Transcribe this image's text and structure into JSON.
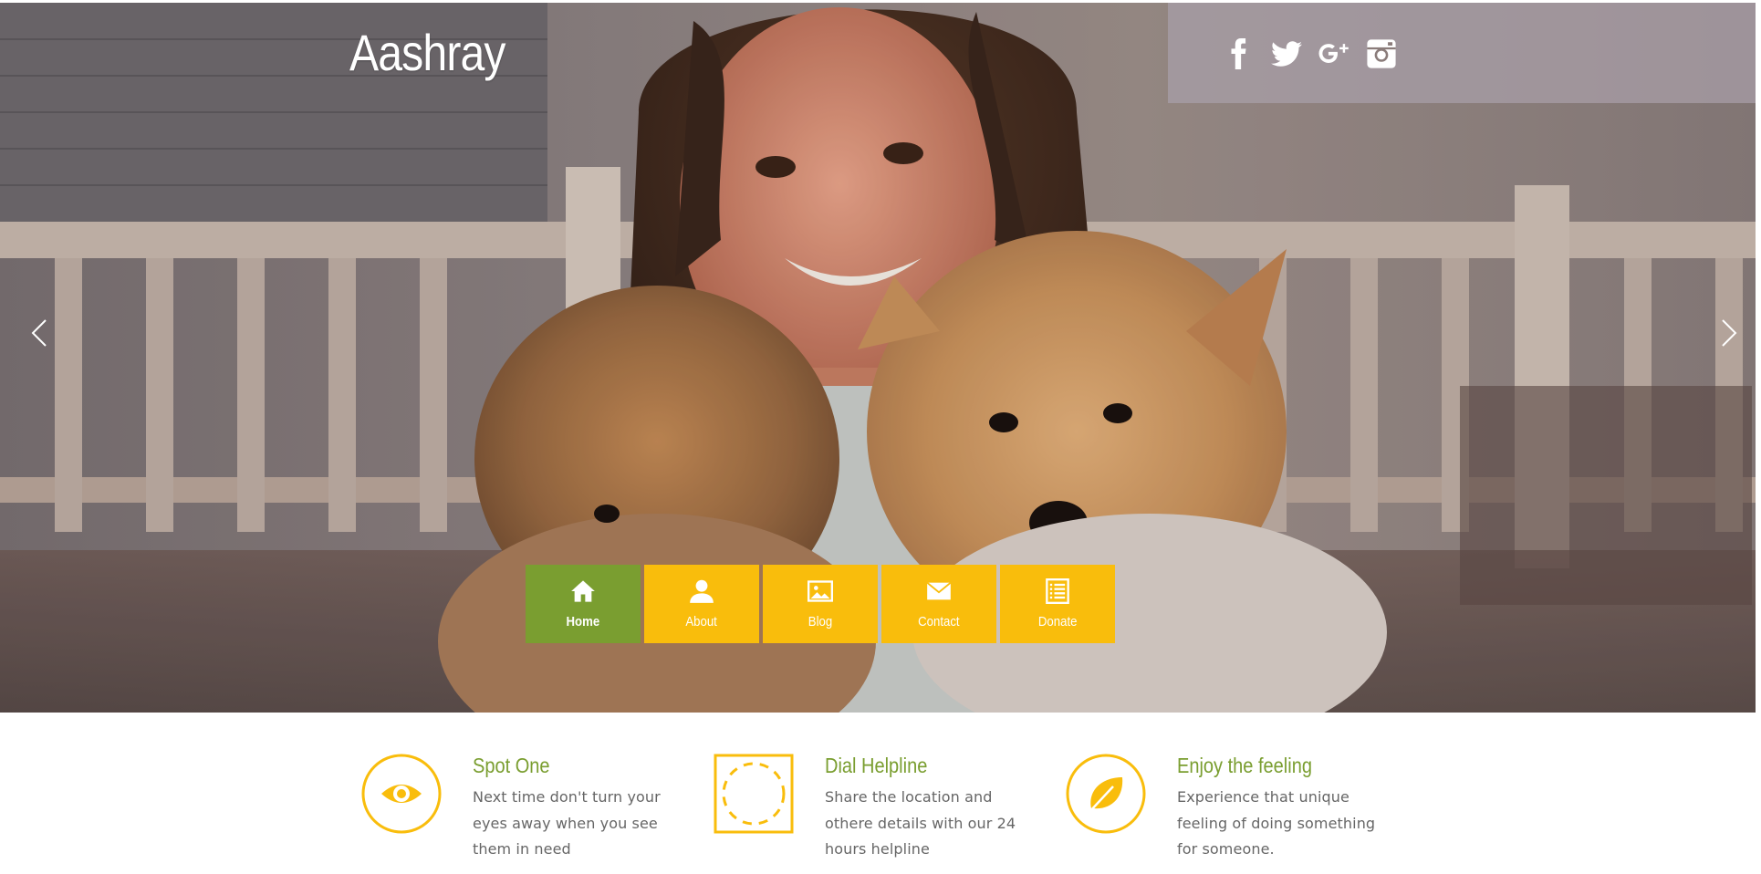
{
  "site": {
    "brand": "Aashray",
    "accent_color": "#f9bd0c",
    "active_color": "#7a9e30"
  },
  "social": [
    {
      "name": "facebook-icon"
    },
    {
      "name": "twitter-icon"
    },
    {
      "name": "google-plus-icon"
    },
    {
      "name": "instagram-icon"
    }
  ],
  "slider": {
    "prev_icon": "chevron-left-icon",
    "next_icon": "chevron-right-icon"
  },
  "nav": {
    "items": [
      {
        "label": "Home",
        "icon": "home-icon",
        "active": true
      },
      {
        "label": "About",
        "icon": "user-icon",
        "active": false
      },
      {
        "label": "Blog",
        "icon": "image-icon",
        "active": false
      },
      {
        "label": "Contact",
        "icon": "envelope-icon",
        "active": false
      },
      {
        "label": "Donate",
        "icon": "list-icon",
        "active": false
      }
    ]
  },
  "features": [
    {
      "title": "Spot One",
      "text": "Next time don't turn your eyes away when you see them in need",
      "icon": "eye-icon"
    },
    {
      "title": "Dial Helpline",
      "text": "Share the location and othere details with our 24 hours helpline",
      "icon": "loading-icon"
    },
    {
      "title": "Enjoy the feeling",
      "text": "Experience that unique feeling of doing something for someone.",
      "icon": "leaf-icon"
    }
  ]
}
